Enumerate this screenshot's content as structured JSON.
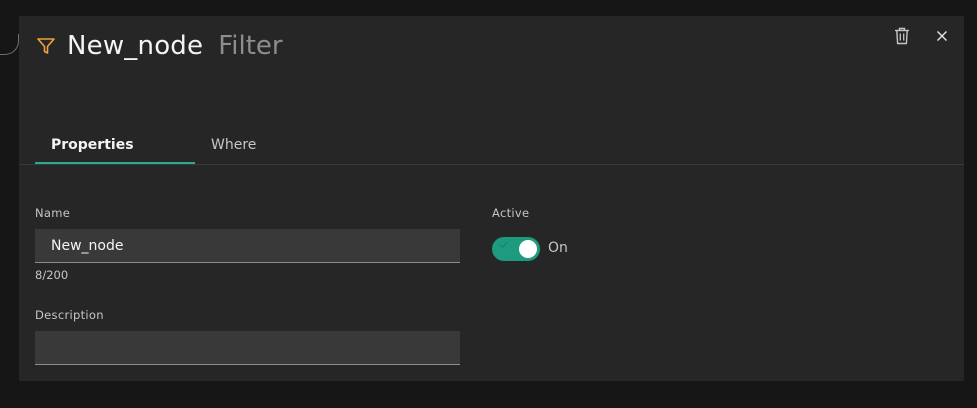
{
  "header": {
    "title": "New_node",
    "subtitle": "Filter",
    "icon": "filter-icon",
    "accent_color": "#f1a13b"
  },
  "actions": {
    "delete_icon": "trash-icon",
    "close_icon": "close-icon"
  },
  "tabs": [
    {
      "label": "Properties",
      "active": true
    },
    {
      "label": "Where",
      "active": false
    }
  ],
  "form": {
    "name": {
      "label": "Name",
      "value": "New_node",
      "counter": "8/200"
    },
    "description": {
      "label": "Description",
      "value": ""
    },
    "active": {
      "label": "Active",
      "state_text": "On",
      "checked": true
    }
  },
  "colors": {
    "tab_indicator": "#2ca88f",
    "toggle_on": "#1e9a7e"
  }
}
